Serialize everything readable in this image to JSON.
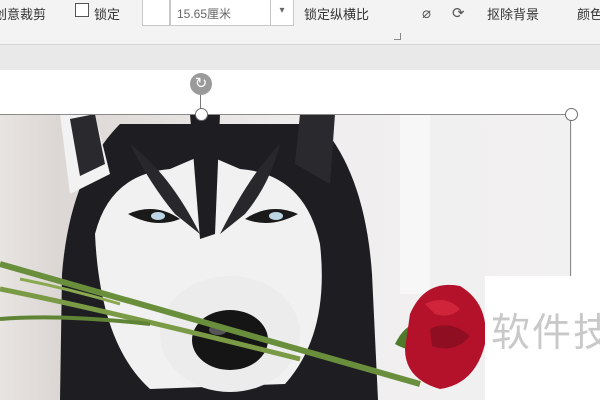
{
  "ribbon": {
    "crop_label": "创意裁剪",
    "checkbox_label": "锁定",
    "width_value": "15.65厘米",
    "lock_aspect_label": "锁定纵横比",
    "remove_bg_label": "抠除背景",
    "color_label": "颜色"
  },
  "watermark": {
    "text": "软件技"
  },
  "colors": {
    "selection_border": "#8a8a8a",
    "rotate_handle": "#9a9a9a",
    "accent": "#d0243a"
  }
}
